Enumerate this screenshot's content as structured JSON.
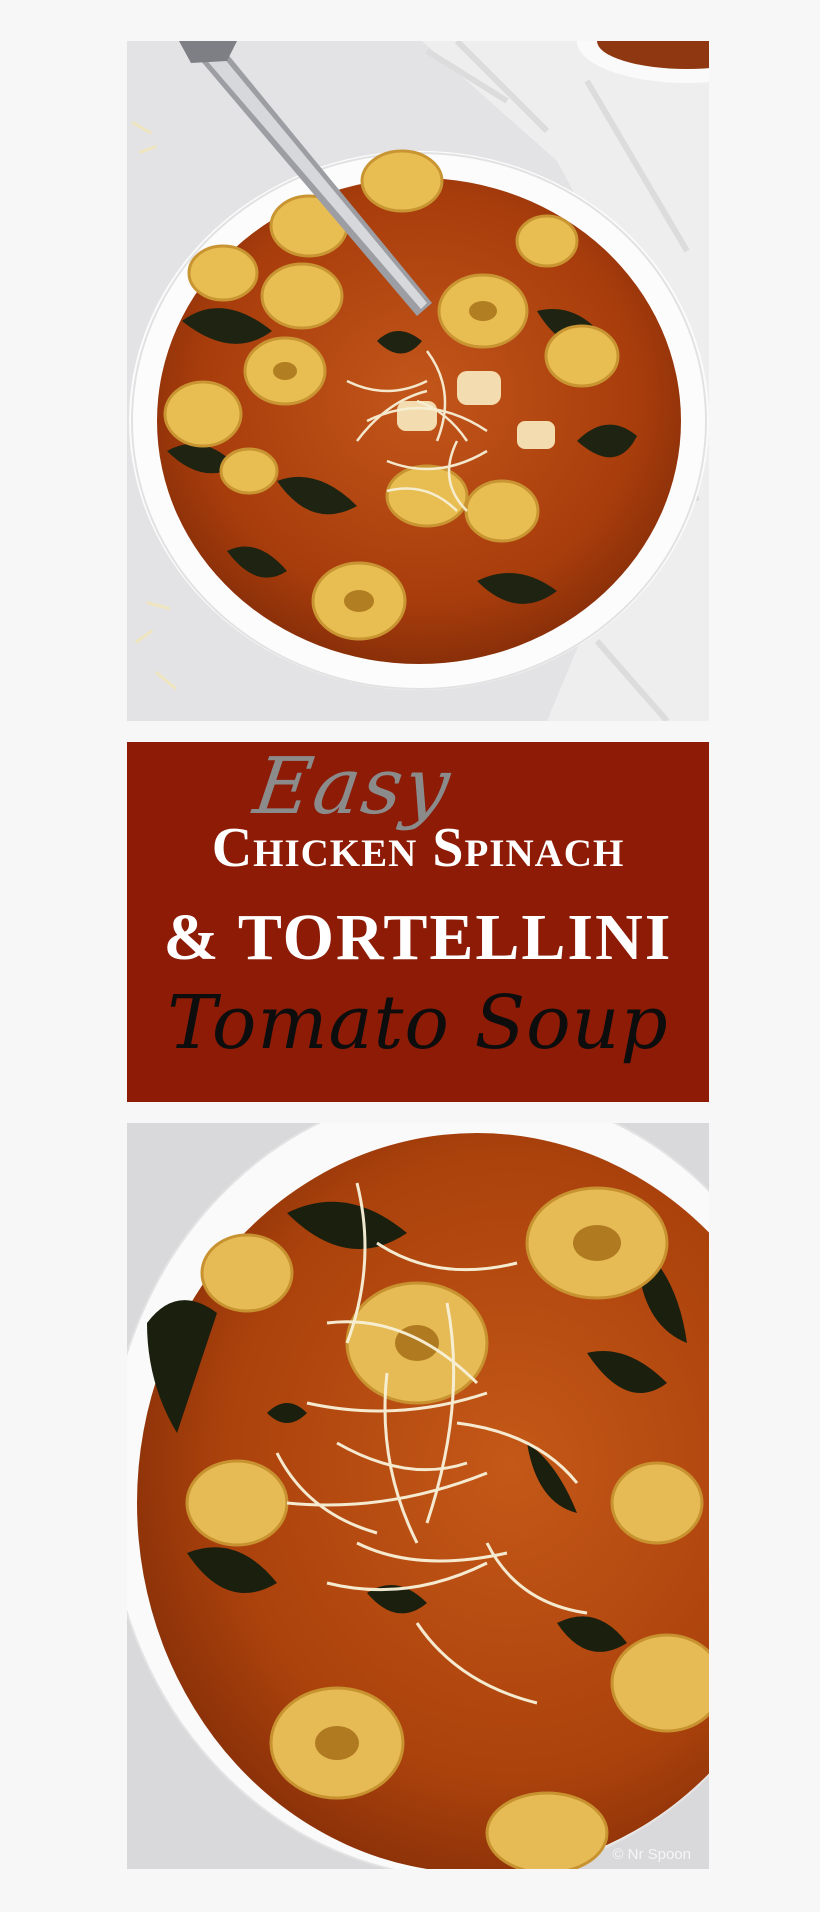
{
  "title": {
    "easy": "Easy",
    "line1": "Chicken Spinach",
    "line2": "& TORTELLINI",
    "line3": "Tomato Soup"
  },
  "watermark": "© Nr Spoon",
  "colors": {
    "banner": "#8d1b06",
    "broth": "#b5470e",
    "bowl": "#fbfbfb",
    "background": "#f7f7f7"
  }
}
